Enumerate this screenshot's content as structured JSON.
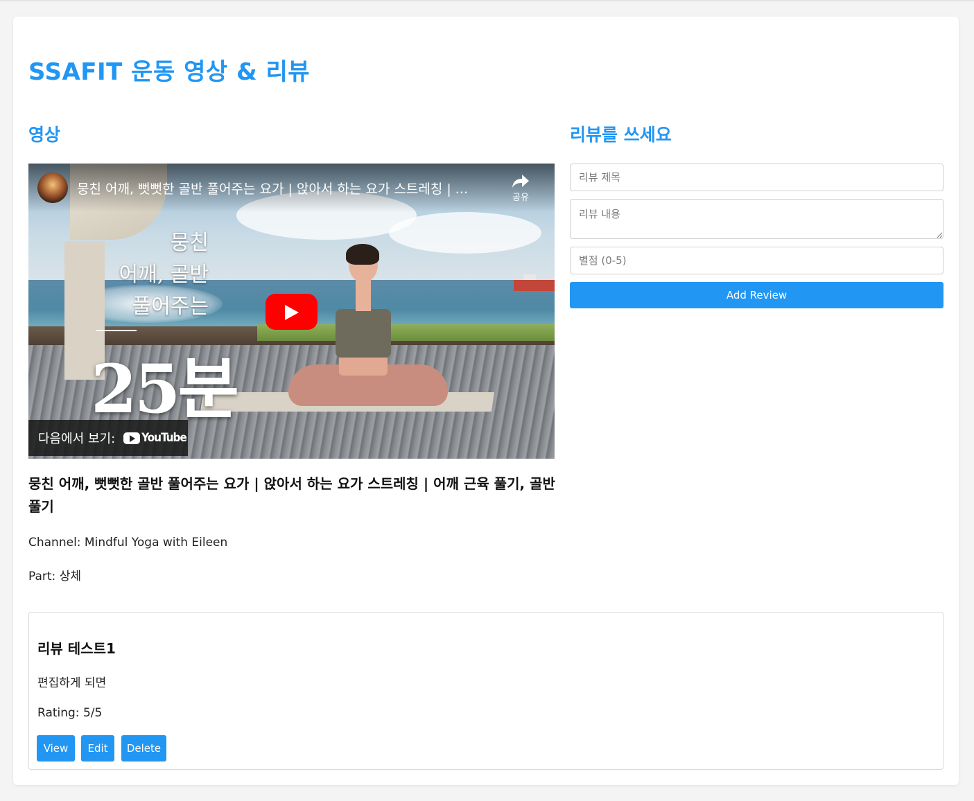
{
  "page": {
    "title": "SSAFIT 운동 영상 & 리뷰",
    "accent_color": "#2196f3"
  },
  "video_section": {
    "heading": "영상",
    "player": {
      "title": "뭉친 어깨, 뻣뻣한 골반 풀어주는 요가 | 앉아서 하는 요가 스트레칭 | ...",
      "share_label": "공유",
      "share_icon": "share-arrow-icon",
      "play_icon": "youtube-play-icon",
      "watch_on_label": "다음에서 보기:",
      "youtube_logo_text": "YouTube",
      "thumbnail_text_1": "뭉친",
      "thumbnail_text_2": "어깨, 골반",
      "thumbnail_text_3": "풀어주는",
      "thumbnail_big_text": "25분"
    },
    "title": "뭉친 어깨, 뻣뻣한 골반 풀어주는 요가 | 앉아서 하는 요가 스트레칭 | 어깨 근육 풀기, 골반풀기",
    "channel_label": "Channel: Mindful Yoga with Eileen",
    "part_label": "Part: 상체"
  },
  "review_form": {
    "heading": "리뷰를 쓰세요",
    "title_placeholder": "리뷰 제목",
    "content_placeholder": "리뷰 내용",
    "rating_placeholder": "별점 (0-5)",
    "submit_label": "Add Review"
  },
  "reviews": [
    {
      "title": "리뷰 테스트1",
      "content": "편집하게 되면",
      "rating_text": "Rating: 5/5",
      "view_label": "View",
      "edit_label": "Edit",
      "delete_label": "Delete"
    }
  ]
}
